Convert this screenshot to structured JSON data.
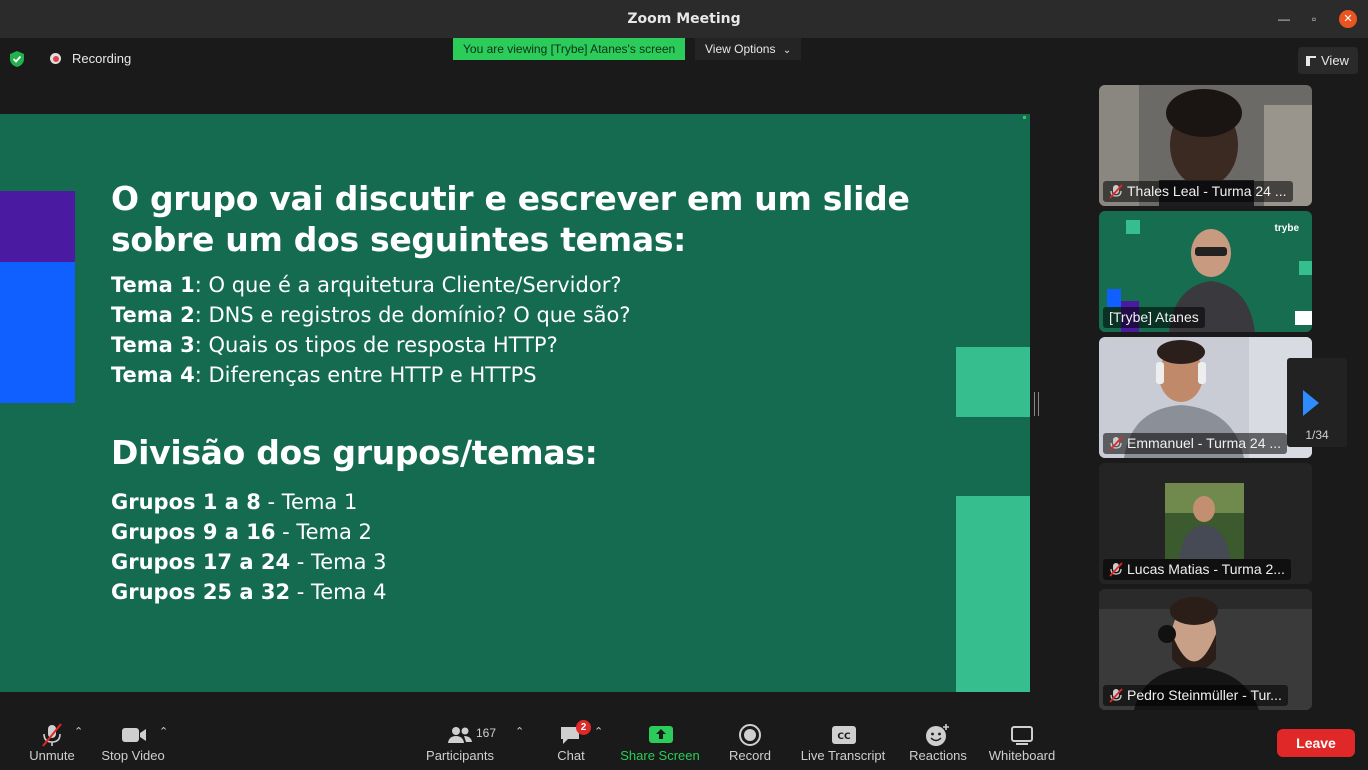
{
  "window": {
    "title": "Zoom Meeting"
  },
  "topbar": {
    "recording_label": "Recording",
    "viewing_banner": "You are viewing [Trybe] Atanes's screen",
    "view_options_label": "View Options",
    "view_label": "View"
  },
  "slide": {
    "heading1_line1": "O grupo vai discutir e escrever em um slide",
    "heading1_line2": "sobre um dos seguintes temas:",
    "temas": [
      {
        "label": "Tema 1",
        "text": ": O que é a arquitetura Cliente/Servidor?"
      },
      {
        "label": "Tema 2",
        "text": ": DNS e registros de domínio? O que são?"
      },
      {
        "label": "Tema 3",
        "text": ": Quais os tipos de resposta HTTP?"
      },
      {
        "label": "Tema 4",
        "text": ": Diferenças entre HTTP e HTTPS"
      }
    ],
    "heading2": "Divisão dos grupos/temas:",
    "grupos": [
      {
        "label": "Grupos 1 a 8",
        "text": " - Tema 1"
      },
      {
        "label": "Grupos 9 a 16",
        "text": " - Tema 2"
      },
      {
        "label": "Grupos 17 a 24",
        "text": " - Tema 3"
      },
      {
        "label": "Grupos 25 a 32",
        "text": " - Tema 4"
      }
    ],
    "colors": {
      "background": "#146b4f",
      "accent_mint": "#37be8f",
      "purple": "#4a1aa0",
      "blue": "#1060ff"
    }
  },
  "participants": [
    {
      "name": "Thales Leal - Turma 24 ...",
      "muted": true
    },
    {
      "name": "[Trybe] Atanes",
      "muted": false,
      "logo_text": "trybe"
    },
    {
      "name": "Emmanuel - Turma 24 ...",
      "muted": true
    },
    {
      "name": "Lucas Matias - Turma 2...",
      "muted": true
    },
    {
      "name": "Pedro Steinmüller - Tur...",
      "muted": true
    }
  ],
  "pager": {
    "count": "1/34"
  },
  "toolbar": {
    "unmute": "Unmute",
    "stop_video": "Stop Video",
    "participants": "Participants",
    "participants_count": "167",
    "chat": "Chat",
    "chat_badge": "2",
    "share_screen": "Share Screen",
    "record": "Record",
    "live_transcript": "Live Transcript",
    "reactions": "Reactions",
    "whiteboard": "Whiteboard",
    "leave": "Leave"
  }
}
